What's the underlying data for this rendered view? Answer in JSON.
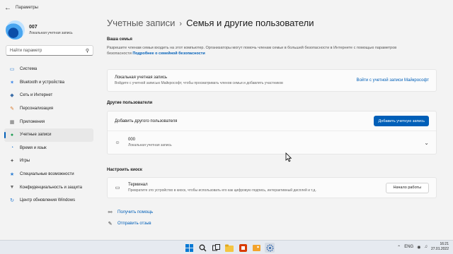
{
  "window": {
    "title": "Параметры"
  },
  "profile": {
    "name": "007",
    "subtitle": "Локальная учетная запись"
  },
  "search": {
    "placeholder": "Найти параметр"
  },
  "sidebar": {
    "items": [
      {
        "label": "Система",
        "icon": "monitor-icon",
        "color": "#2b7cd3"
      },
      {
        "label": "Bluetooth и устройства",
        "icon": "bluetooth-icon",
        "color": "#1a73e8"
      },
      {
        "label": "Сеть и Интернет",
        "icon": "network-icon",
        "color": "#3c6ea8"
      },
      {
        "label": "Персонализация",
        "icon": "brush-icon",
        "color": "#d87a2b"
      },
      {
        "label": "Приложения",
        "icon": "apps-icon",
        "color": "#6b6b6b"
      },
      {
        "label": "Учетные записи",
        "icon": "person-icon",
        "color": "#1f9d55",
        "active": true
      },
      {
        "label": "Время и язык",
        "icon": "globe-clock-icon",
        "color": "#2b7cd3"
      },
      {
        "label": "Игры",
        "icon": "gamepad-icon",
        "color": "#555555"
      },
      {
        "label": "Специальные возможности",
        "icon": "accessibility-icon",
        "color": "#2b7cd3"
      },
      {
        "label": "Конфиденциальность и защита",
        "icon": "shield-icon",
        "color": "#6b6b6b"
      },
      {
        "label": "Центр обновления Windows",
        "icon": "update-icon",
        "color": "#2b7cd3"
      }
    ]
  },
  "breadcrumb": {
    "parent": "Учетные записи",
    "separator": "›",
    "current": "Семья и другие пользователи"
  },
  "family": {
    "title": "Ваша семья",
    "description": "Разрешите членам семьи входить на этот компьютер. Организаторы могут помочь членам семьи в большей безопасности в Интернете с помощью параметров безопасности",
    "link": "Подробнее о семейной безопасности",
    "card_title": "Локальная учетная запись",
    "card_sub": "Войдите с учетной записью Майкрософт, чтобы просматривать членов семьи и добавлять участников",
    "card_action": "Войти с учетной записи Майкрософт"
  },
  "other_users": {
    "title": "Другие пользователи",
    "add_label": "Добавить другого пользователя",
    "add_button": "Добавить учетную запись",
    "user_name": "000",
    "user_type": "Локальная учетная запись"
  },
  "kiosk": {
    "title": "Настроить киоск",
    "card_title": "Терминал",
    "card_sub": "Превратите это устройство в киоск, чтобы использовать его как цифровую подпись, интерактивный дисплей и т.д.",
    "button": "Начало работы"
  },
  "help": {
    "get_help": "Получить помощь",
    "feedback": "Отправить отзыв"
  },
  "taskbar": {
    "apps": [
      "windows-icon",
      "search-icon",
      "task-view-icon",
      "file-explorer-icon",
      "office-icon",
      "photos-icon",
      "settings-icon"
    ],
    "tray_lang": "ENG",
    "time": "16:21",
    "date": "27.01.2022"
  },
  "colors": {
    "accent": "#005fb8",
    "background": "#f3f3f3",
    "card": "#fbfbfb"
  }
}
